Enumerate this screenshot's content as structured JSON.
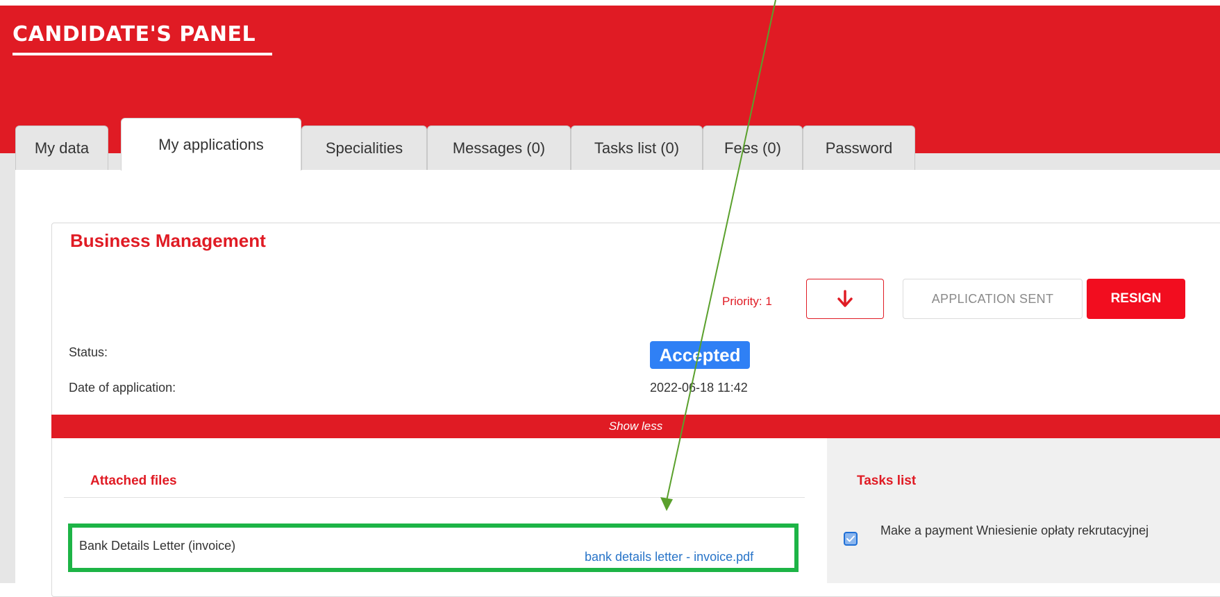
{
  "header": {
    "panel_title": "CANDIDATE'S PANEL"
  },
  "tabs": [
    {
      "label": "My data",
      "active": false
    },
    {
      "label": "My applications",
      "active": true
    },
    {
      "label": "Specialities",
      "active": false
    },
    {
      "label": "Messages (0)",
      "active": false
    },
    {
      "label": "Tasks list (0)",
      "active": false
    },
    {
      "label": "Fees (0)",
      "active": false
    },
    {
      "label": "Password",
      "active": false
    }
  ],
  "application": {
    "title": "Business Management",
    "priority_label": "Priority: 1",
    "priority_button_icon": "arrow-down-icon",
    "sent_label": "APPLICATION SENT",
    "resign_label": "RESIGN",
    "status_label": "Status:",
    "status_value": "Accepted",
    "date_label": "Date of application:",
    "date_value": "2022-06-18 11:42",
    "show_less_label": "Show less"
  },
  "attached_files": {
    "title": "Attached files",
    "items": [
      {
        "name": "Bank Details Letter (invoice)",
        "file": "bank details letter - invoice.pdf"
      }
    ]
  },
  "tasks_list": {
    "title": "Tasks list",
    "items": [
      {
        "label": "Make a payment Wniesienie opłaty rekrutacyjnej",
        "checked": true
      }
    ]
  },
  "colors": {
    "brand_red": "#e01b24",
    "badge_blue": "#2f80f5",
    "highlight_green": "#1db446",
    "annotation_arrow": "#5aa02c"
  }
}
